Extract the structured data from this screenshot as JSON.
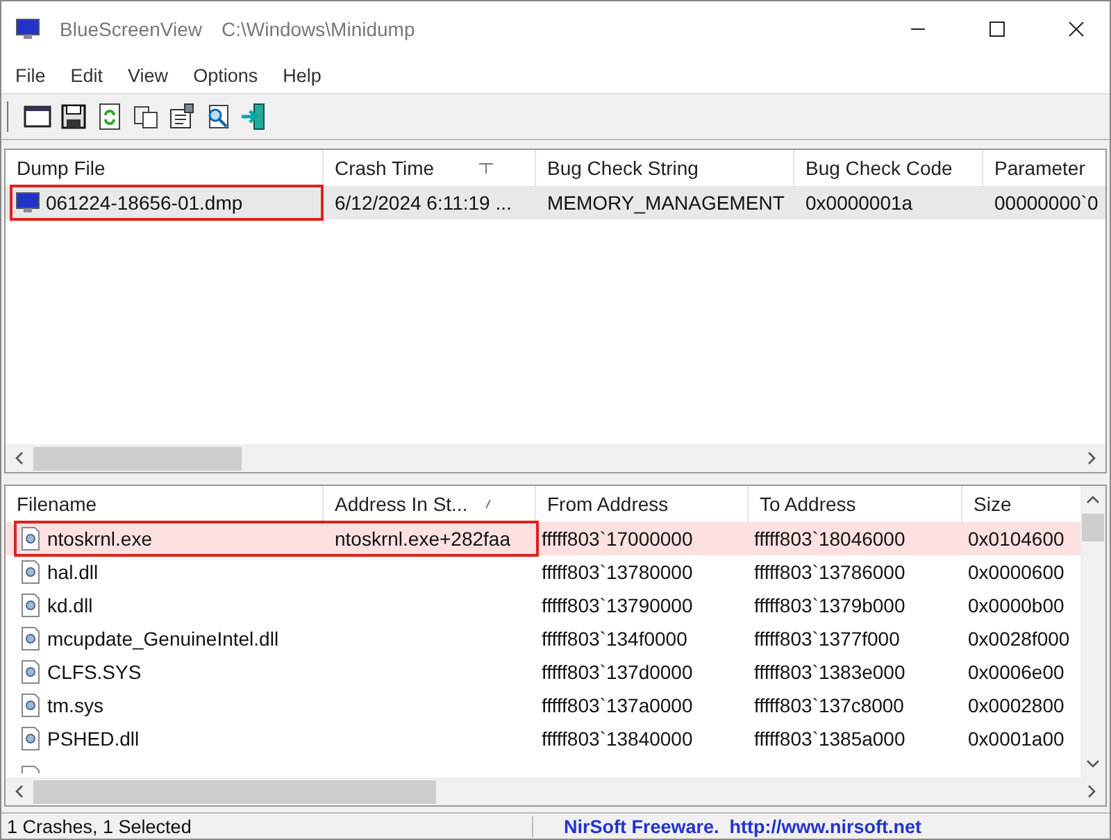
{
  "window": {
    "title": "BlueScreenView",
    "path": "C:\\Windows\\Minidump"
  },
  "menu": [
    "File",
    "Edit",
    "View",
    "Options",
    "Help"
  ],
  "toolbar": [
    {
      "kind": "properties"
    },
    {
      "kind": "save"
    },
    {
      "kind": "refresh"
    },
    {
      "kind": "copy"
    },
    {
      "kind": "options"
    },
    {
      "kind": "find"
    },
    {
      "kind": "exit"
    }
  ],
  "dump_list": {
    "columns": [
      {
        "label": "Dump File",
        "sorted": false
      },
      {
        "label": "Crash Time",
        "sorted": true
      },
      {
        "label": "Bug Check String",
        "sorted": false
      },
      {
        "label": "Bug Check Code",
        "sorted": false
      },
      {
        "label": "Parameter",
        "sorted": false
      }
    ],
    "rows": [
      {
        "cells": [
          "061224-18656-01.dmp",
          "6/12/2024 6:11:19 ...",
          "MEMORY_MANAGEMENT",
          "0x0000001a",
          "00000000`0"
        ],
        "selected": true,
        "outlined": true
      }
    ]
  },
  "driver_list": {
    "columns": [
      {
        "label": "Filename",
        "sorted": false
      },
      {
        "label": "Address In St...",
        "sorted": true
      },
      {
        "label": "From Address",
        "sorted": false
      },
      {
        "label": "To Address",
        "sorted": false
      },
      {
        "label": "Size",
        "sorted": false
      }
    ],
    "rows": [
      {
        "cells": [
          "ntoskrnl.exe",
          "ntoskrnl.exe+282faa",
          "fffff803`17000000",
          "fffff803`18046000",
          "0x0104600"
        ],
        "in_stack": true,
        "outlined": true
      },
      {
        "cells": [
          "hal.dll",
          "",
          "fffff803`13780000",
          "fffff803`13786000",
          "0x0000600"
        ],
        "in_stack": false,
        "outlined": false
      },
      {
        "cells": [
          "kd.dll",
          "",
          "fffff803`13790000",
          "fffff803`1379b000",
          "0x0000b00"
        ],
        "in_stack": false,
        "outlined": false
      },
      {
        "cells": [
          "mcupdate_GenuineIntel.dll",
          "",
          "fffff803`134f0000",
          "fffff803`1377f000",
          "0x0028f000"
        ],
        "in_stack": false,
        "outlined": false
      },
      {
        "cells": [
          "CLFS.SYS",
          "",
          "fffff803`137d0000",
          "fffff803`1383e000",
          "0x0006e00"
        ],
        "in_stack": false,
        "outlined": false
      },
      {
        "cells": [
          "tm.sys",
          "",
          "fffff803`137a0000",
          "fffff803`137c8000",
          "0x0002800"
        ],
        "in_stack": false,
        "outlined": false
      },
      {
        "cells": [
          "PSHED.dll",
          "",
          "fffff803`13840000",
          "fffff803`1385a000",
          "0x0001a00"
        ],
        "in_stack": false,
        "outlined": false
      }
    ]
  },
  "status_bar": {
    "summary": "1 Crashes, 1 Selected",
    "credit": "NirSoft Freeware.  http://www.nirsoft.net"
  }
}
